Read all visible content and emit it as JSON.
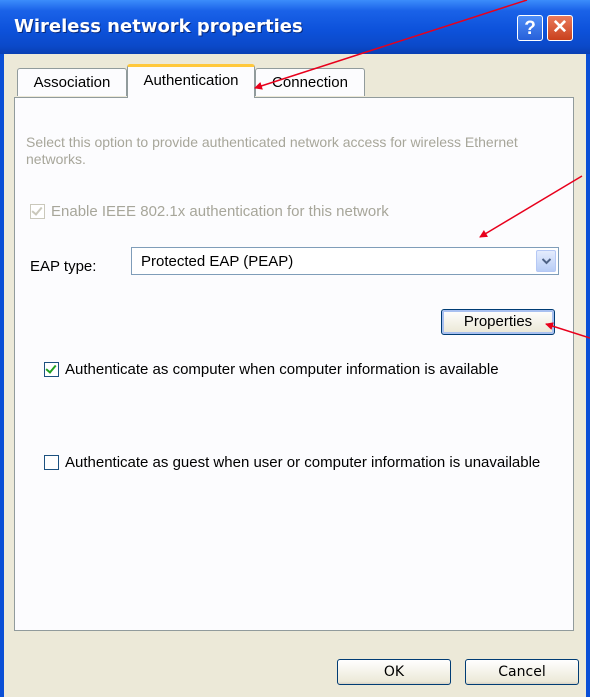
{
  "window": {
    "title": "Wireless network properties",
    "help_label": "?",
    "close_label": "✕"
  },
  "tabs": [
    {
      "label": "Association",
      "active": false
    },
    {
      "label": "Authentication",
      "active": true
    },
    {
      "label": "Connection",
      "active": false
    }
  ],
  "authentication": {
    "description": "Select this option to provide authenticated network access for wireless Ethernet networks.",
    "ieee_label": "Enable IEEE 802.1x authentication for this network",
    "ieee_checked": true,
    "ieee_enabled": false,
    "eap_label": "EAP type:",
    "eap_value": "Protected EAP (PEAP)",
    "properties_label": "Properties",
    "computer_auth_label": "Authenticate as computer when computer information is available",
    "computer_auth_checked": true,
    "guest_auth_label": "Authenticate as guest when user or computer information is unavailable",
    "guest_auth_checked": false
  },
  "footer": {
    "ok_label": "OK",
    "cancel_label": "Cancel"
  },
  "colors": {
    "titlebar": "#0b4fd6",
    "annotation_arrow": "#e8001c",
    "active_tab_highlight": "#ffc83c"
  }
}
